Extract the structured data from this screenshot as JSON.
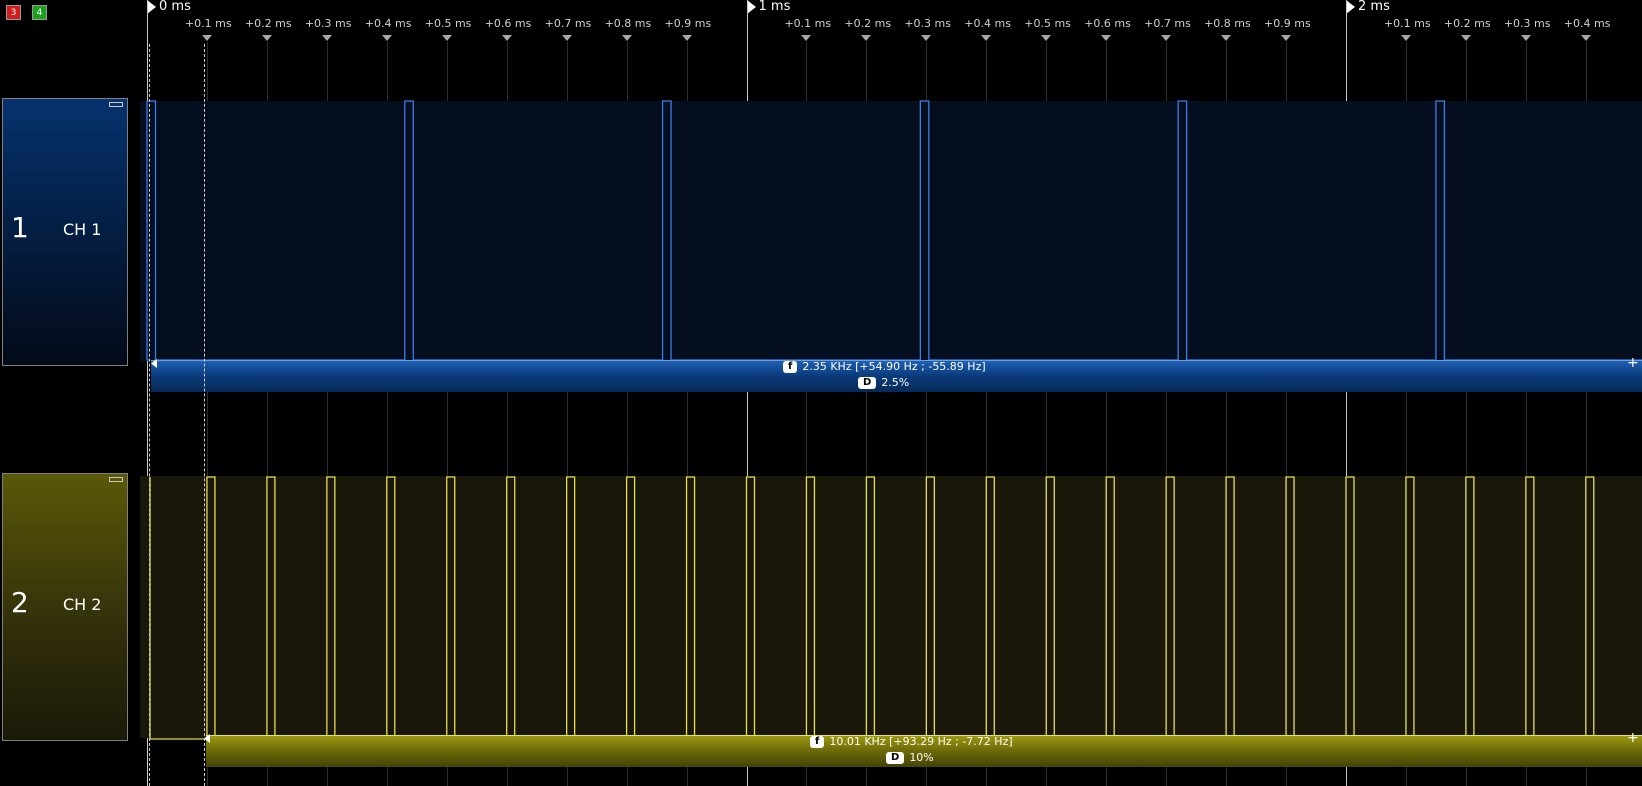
{
  "colors": {
    "ch1": "#3c7de6",
    "ch2": "#e6e04a",
    "ch1_area": "#040e1e",
    "ch2_area": "#18170a",
    "ch1_bar_top": "#1e5fb4",
    "ch1_bar_bottom": "#0a2a58",
    "ch2_bar_top": "#8c8a12",
    "ch2_bar_bottom": "#3c3a06",
    "background": "#000000",
    "grid": "#2e2e2e",
    "major_grid": "#c9c9c9",
    "badge_red": "#d21d1d",
    "badge_green": "#1ea01e"
  },
  "badges": [
    {
      "label": "3",
      "color": "#d21d1d"
    },
    {
      "label": "4",
      "color": "#1ea01e"
    }
  ],
  "ruler": {
    "majors": [
      {
        "label": "0 ms",
        "ms": 0
      },
      {
        "label": "1 ms",
        "ms": 1
      },
      {
        "label": "2 ms",
        "ms": 2
      }
    ],
    "minor_labels": [
      "+0.1 ms",
      "+0.2 ms",
      "+0.3 ms",
      "+0.4 ms",
      "+0.5 ms",
      "+0.6 ms",
      "+0.7 ms",
      "+0.8 ms",
      "+0.9 ms"
    ],
    "last_minor_count": 4
  },
  "channels": [
    {
      "id": "ch1",
      "number": "1",
      "name": "CH 1",
      "frequency_icon": "f",
      "frequency": "2.35 KHz [+54.90 Hz ; -55.89 Hz]",
      "duty_icon": "D",
      "duty": "2.5%",
      "period_ms": 0.43,
      "pulse_width_ms": 0.0108,
      "first_pulse_ms": 0.0
    },
    {
      "id": "ch2",
      "number": "2",
      "name": "CH 2",
      "frequency_icon": "f",
      "frequency": "10.01 KHz [+93.29 Hz ; -7.72 Hz]",
      "duty_icon": "D",
      "duty": "10%",
      "period_ms": 0.1,
      "pulse_width_ms": 0.01,
      "first_pulse_ms": 0.1
    }
  ],
  "cursor_icons": [
    "cursor-a-icon",
    "cursor-b-icon"
  ],
  "add_icon": "+"
}
